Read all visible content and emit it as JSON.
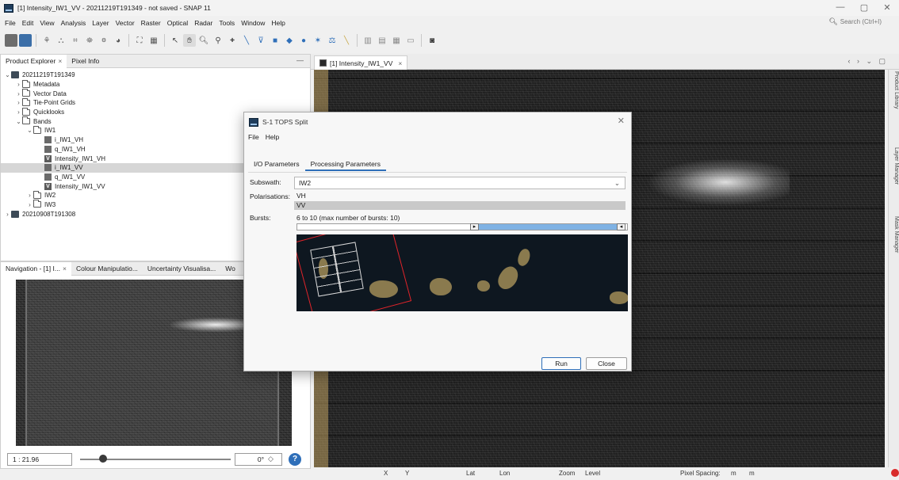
{
  "window": {
    "title": "[1] Intensity_IW1_VV - 20211219T191349 - not saved - SNAP 11",
    "controls": [
      "—",
      "▢",
      "✕"
    ]
  },
  "menu": [
    "File",
    "Edit",
    "View",
    "Analysis",
    "Layer",
    "Vector",
    "Raster",
    "Optical",
    "Radar",
    "Tools",
    "Window",
    "Help"
  ],
  "search": {
    "placeholder": "Search (Ctrl+I)"
  },
  "product_explorer": {
    "tabs": [
      "Product Explorer",
      "Pixel Info"
    ],
    "tree": [
      {
        "label": "20211219T191349",
        "level": 0,
        "type": "product",
        "chev": "⌄"
      },
      {
        "label": "Metadata",
        "level": 1,
        "type": "folder",
        "chev": "›"
      },
      {
        "label": "Vector Data",
        "level": 1,
        "type": "folder",
        "chev": "›"
      },
      {
        "label": "Tie-Point Grids",
        "level": 1,
        "type": "folder",
        "chev": "›"
      },
      {
        "label": "Quicklooks",
        "level": 1,
        "type": "folder",
        "chev": "›"
      },
      {
        "label": "Bands",
        "level": 1,
        "type": "folder",
        "chev": "⌄"
      },
      {
        "label": "IW1",
        "level": 2,
        "type": "folder",
        "chev": "⌄"
      },
      {
        "label": "i_IW1_VH",
        "level": 3,
        "type": "band"
      },
      {
        "label": "q_IW1_VH",
        "level": 3,
        "type": "band"
      },
      {
        "label": "Intensity_IW1_VH",
        "level": 3,
        "type": "vband"
      },
      {
        "label": "i_IW1_VV",
        "level": 3,
        "type": "band",
        "selected": true
      },
      {
        "label": "q_IW1_VV",
        "level": 3,
        "type": "band"
      },
      {
        "label": "Intensity_IW1_VV",
        "level": 3,
        "type": "vband"
      },
      {
        "label": "IW2",
        "level": 2,
        "type": "folder",
        "chev": "›"
      },
      {
        "label": "IW3",
        "level": 2,
        "type": "folder",
        "chev": "›"
      },
      {
        "label": "20210908T191308",
        "level": 0,
        "type": "product",
        "chev": "›"
      }
    ]
  },
  "navigation_panel": {
    "tabs": [
      "Navigation - [1] I...",
      "Colour Manipulatio...",
      "Uncertainty Visualisa...",
      "Wo"
    ],
    "zoom": "1 : 21.96",
    "rotation": "0°",
    "zoom_level": 0.15
  },
  "image_view": {
    "tab": "[1] Intensity_IW1_VV"
  },
  "right_strip": [
    "Product Library",
    "Layer Manager",
    "Mask Manager"
  ],
  "status_bar": {
    "x": "X",
    "y": "Y",
    "lat": "Lat",
    "lon": "Lon",
    "zoom": "Zoom",
    "level": "Level",
    "pixel_spacing": "Pixel Spacing:",
    "m1": "m",
    "m2": "m"
  },
  "dialog": {
    "title": "S-1 TOPS Split",
    "menu": [
      "File",
      "Help"
    ],
    "tabs": [
      "I/O Parameters",
      "Processing Parameters"
    ],
    "subswath_label": "Subswath:",
    "subswath_value": "IW2",
    "polarisations_label": "Polarisations:",
    "polarisations": [
      "VH",
      "VV"
    ],
    "polarisation_selected": "VV",
    "bursts_label": "Bursts:",
    "bursts_text": "6 to 10 (max number of bursts: 10)",
    "burst_min": 6,
    "burst_max": 10,
    "burst_total": 10,
    "run_label": "Run",
    "close_label": "Close",
    "close_icon": "✕"
  }
}
